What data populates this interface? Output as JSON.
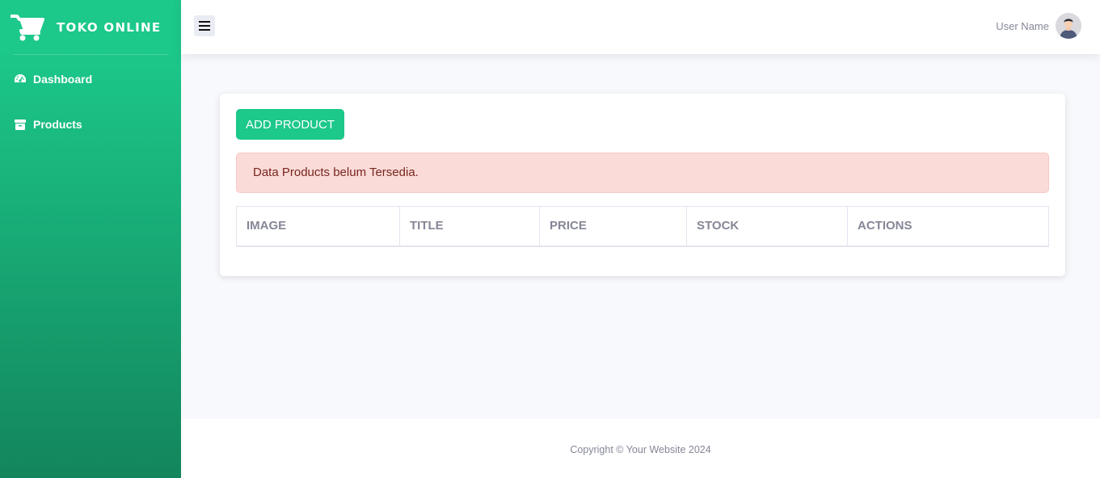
{
  "sidebar": {
    "brand": "TOKO ONLINE",
    "brand_icon": "shopping-cart-icon",
    "items": [
      {
        "label": "Dashboard",
        "icon": "tachometer-icon"
      },
      {
        "label": "Products",
        "icon": "box-icon"
      }
    ]
  },
  "topbar": {
    "toggle_icon": "hamburger-menu-icon",
    "user_name": "User Name",
    "avatar_icon": "user-avatar-icon"
  },
  "main": {
    "add_button": "ADD PRODUCT",
    "alert": "Data Products belum Tersedia.",
    "table": {
      "columns": [
        "IMAGE",
        "TITLE",
        "PRICE",
        "STOCK",
        "ACTIONS"
      ],
      "rows": []
    }
  },
  "footer": {
    "copyright": "Copyright © Your Website 2024"
  },
  "colors": {
    "primary": "#1cc88a",
    "primary_dark": "#13855c",
    "alert_bg": "#fadbd8",
    "alert_text": "#78261f"
  }
}
